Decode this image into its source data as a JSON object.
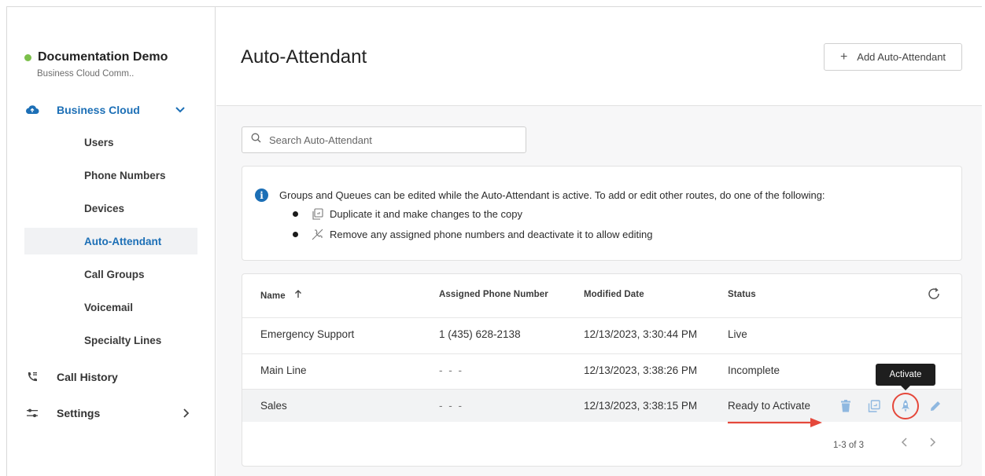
{
  "org": {
    "name": "Documentation Demo",
    "subtitle": "Business Cloud Comm..",
    "status_color": "#7cc04b"
  },
  "sidebar": {
    "business_cloud": {
      "label": "Business Cloud",
      "icon": "cloud-icon"
    },
    "sub_items": [
      {
        "label": "Users"
      },
      {
        "label": "Phone Numbers"
      },
      {
        "label": "Devices"
      },
      {
        "label": "Auto-Attendant",
        "active": true
      },
      {
        "label": "Call Groups"
      },
      {
        "label": "Voicemail"
      },
      {
        "label": "Specialty Lines"
      }
    ],
    "call_history": {
      "label": "Call History",
      "icon": "phone-list-icon"
    },
    "settings": {
      "label": "Settings",
      "icon": "sliders-icon"
    }
  },
  "header": {
    "title": "Auto-Attendant",
    "add_button": "Add Auto-Attendant"
  },
  "search": {
    "placeholder": "Search Auto-Attendant"
  },
  "info": {
    "text": "Groups and Queues can be edited while the Auto-Attendant is active. To add or edit other routes, do one of the following:",
    "bullets": [
      {
        "icon": "duplicate-icon",
        "text": "Duplicate it and make changes to the copy"
      },
      {
        "icon": "remove-number-icon",
        "text": "Remove any assigned phone numbers and deactivate it to allow editing"
      }
    ]
  },
  "table": {
    "columns": {
      "name": "Name",
      "phone": "Assigned Phone Number",
      "modified": "Modified Date",
      "status": "Status"
    },
    "rows": [
      {
        "name": "Emergency Support",
        "phone": "1 (435) 628-2138",
        "modified": "12/13/2023, 3:30:44 PM",
        "status": "Live"
      },
      {
        "name": "Main Line",
        "phone": "- - -",
        "modified": "12/13/2023, 3:38:26 PM",
        "status": "Incomplete"
      },
      {
        "name": "Sales",
        "phone": "- - -",
        "modified": "12/13/2023, 3:38:15 PM",
        "status": "Ready to Activate"
      }
    ],
    "tooltip": "Activate",
    "pagination": "1-3 of 3"
  },
  "colors": {
    "accent": "#1c6fb6",
    "highlight": "#e5483b",
    "action_icon": "#8fb8e0"
  }
}
